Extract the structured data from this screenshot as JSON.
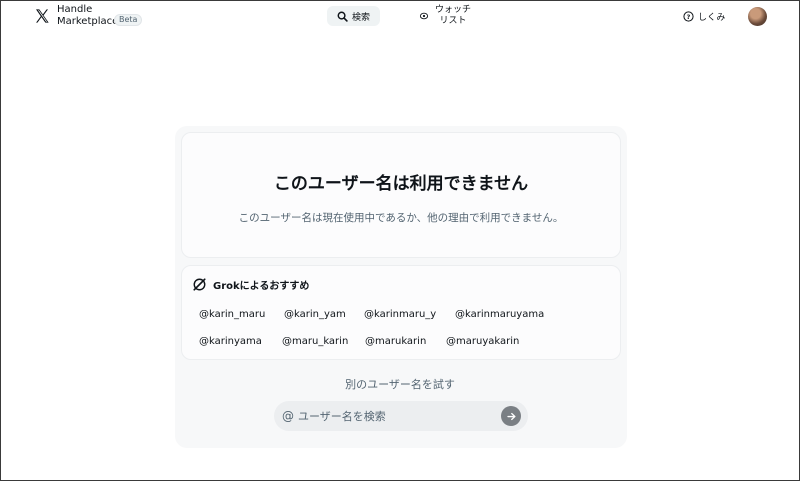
{
  "header": {
    "brand_line1": "Handle",
    "brand_line2": "Marketplace",
    "badge": "Beta",
    "search_label": "検索",
    "watch_line1": "ウォッチ",
    "watch_line2": "リスト",
    "how_label": "しくみ"
  },
  "result": {
    "title": "このユーザー名は利用できません",
    "description": "このユーザー名は現在使用中であるか、他の理由で利用できません。"
  },
  "grok": {
    "heading": "Grokによるおすすめ",
    "suggestions": [
      "@karin_maru",
      "@karin_yam",
      "@karinmaru_y",
      "@karinmaruyama",
      "@karinyama",
      "@maru_karin",
      "@marukarin",
      "@maruyakarin"
    ]
  },
  "try_again": {
    "label": "別のユーザー名を試す",
    "at_symbol": "@",
    "placeholder": "ユーザー名を検索"
  },
  "icons": {
    "logo": "x-logo-icon",
    "search": "search-icon",
    "watch": "eye-icon",
    "help": "question-circle-icon",
    "grok": "grok-icon",
    "submit": "arrow-right-icon"
  },
  "colors": {
    "text": "#0f1419",
    "muted": "#536471",
    "submit_button": "#7a7f84"
  }
}
